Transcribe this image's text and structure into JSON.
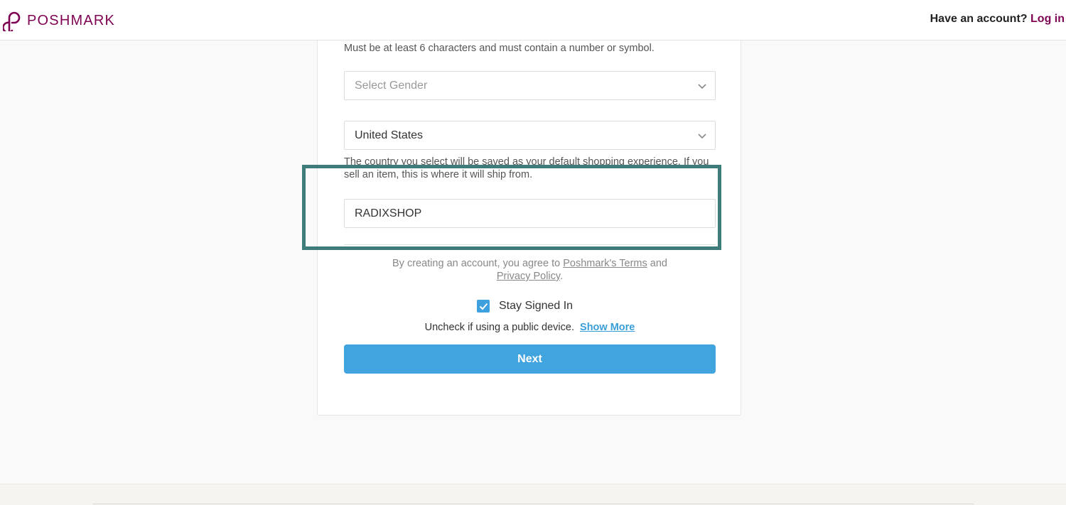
{
  "header": {
    "brand": "POSHMARK",
    "account_prompt": "Have an account?",
    "login_label": "Log in",
    "brand_color": "#7f0353"
  },
  "form": {
    "password_hint": "Must be at least 6 characters and must contain a number or symbol.",
    "gender_placeholder": "Select Gender",
    "country_value": "United States",
    "country_hint": "The country you select will be saved as your default shopping experience. If you sell an item, this is where it will ship from.",
    "username_value": "RADIXSHOP",
    "terms_prefix": "By creating an account, you agree to",
    "terms_link": "Poshmark's Terms",
    "terms_and": "and",
    "privacy_link": "Privacy Policy",
    "terms_suffix": ".",
    "stay_signed_label": "Stay Signed In",
    "stay_signed_checked": true,
    "public_device_text": "Uncheck if using a public device.",
    "show_more_label": "Show More",
    "next_label": "Next",
    "accent_color": "#42a4df"
  },
  "icons": {
    "logo": "poshmark-logo-icon",
    "dropdown": "chevron-down-icon",
    "check": "check-icon"
  },
  "highlight_color": "#3f7b7a"
}
